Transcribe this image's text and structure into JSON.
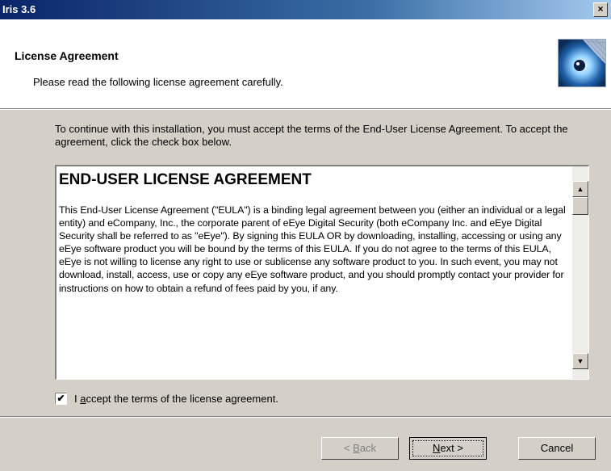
{
  "window": {
    "title": "Iris 3.6",
    "close_glyph": "×"
  },
  "header": {
    "title": "License Agreement",
    "subtitle": "Please read the following license agreement carefully.",
    "logo_icon": "eye-logo-icon"
  },
  "intro_text": "To continue with this installation, you must accept the terms of the End-User License Agreement.  To accept the agreement, click the check box below.",
  "license": {
    "heading": "END-USER LICENSE AGREEMENT",
    "body": "This End-User License Agreement (\"EULA\") is a binding legal agreement between you (either an individual or a legal entity) and eCompany, Inc., the corporate parent of eEye Digital Security (both eCompany Inc. and eEye Digital Security shall be referred to as \"eEye\").  By signing this EULA OR by downloading, installing, accessing or using any eEye software product you will be bound by the terms of this EULA.  If you do not agree to the terms of this EULA, eEye is not willing to license any right to use or sublicense any software product to you.  In such event, you may not download, install, access, use or copy any eEye software product, and you should promptly contact your provider for instructions on how to obtain a refund of fees paid by you, if any."
  },
  "accept": {
    "checked": true,
    "check_glyph": "✔",
    "label_pre": "I ",
    "label_accel": "a",
    "label_post": "ccept the terms of the license agreement."
  },
  "buttons": {
    "back": {
      "pre": "< ",
      "accel": "B",
      "post": "ack"
    },
    "next": {
      "accel": "N",
      "post": "ext >"
    },
    "cancel": "Cancel"
  }
}
